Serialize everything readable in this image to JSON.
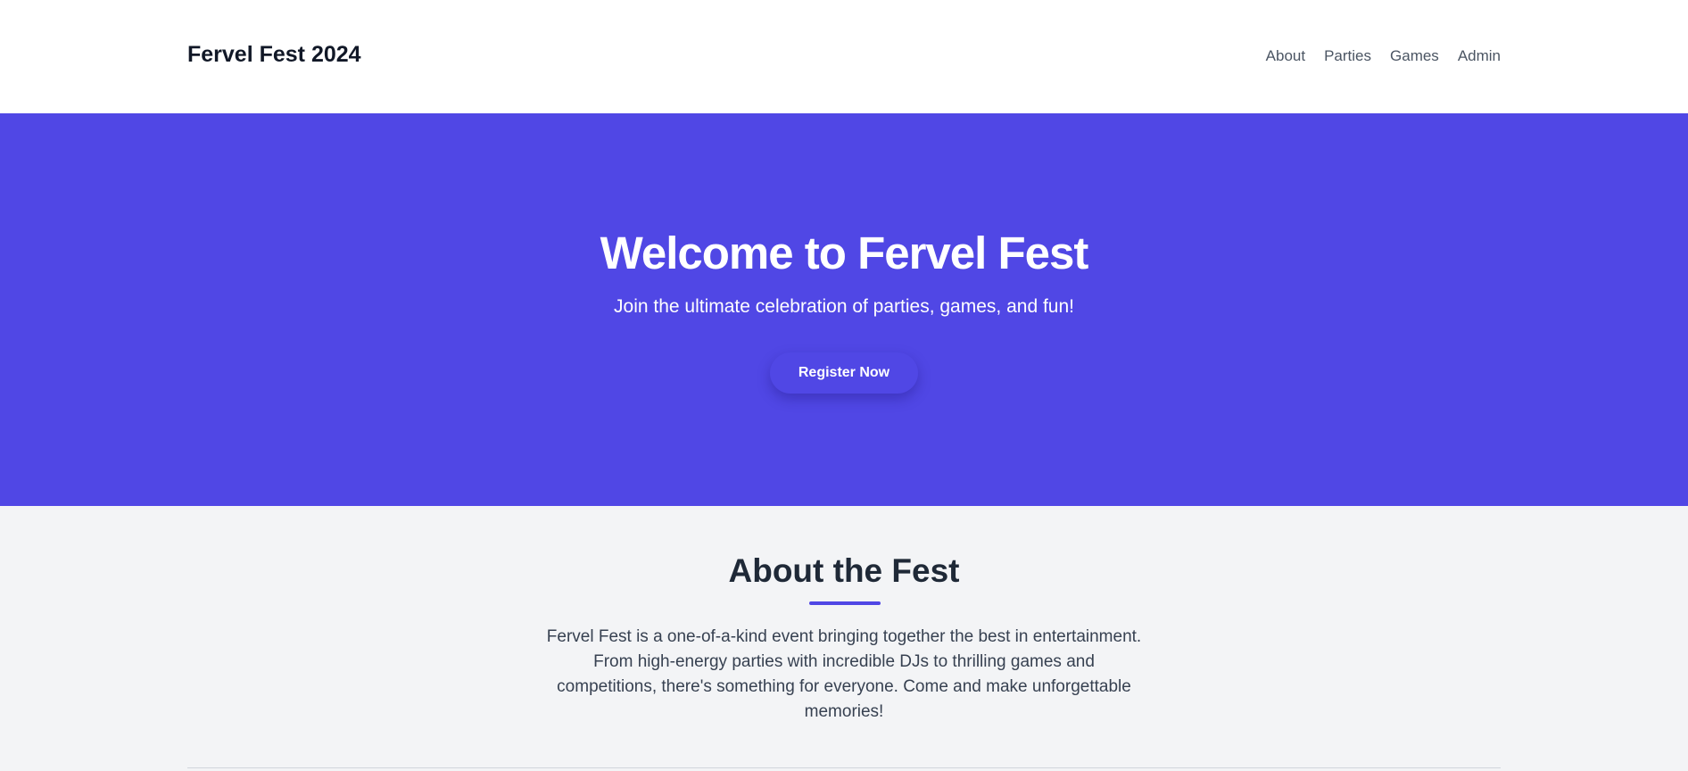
{
  "header": {
    "brand": "Fervel Fest 2024",
    "nav": [
      "About",
      "Parties",
      "Games",
      "Admin"
    ]
  },
  "hero": {
    "title": "Welcome to Fervel Fest",
    "subtitle": "Join the ultimate celebration of parties, games, and fun!",
    "cta_label": "Register Now",
    "background": "#5047e5"
  },
  "about": {
    "title": "About the Fest",
    "text": "Fervel Fest is a one-of-a-kind event bringing together the best in entertainment. From high-energy parties with incredible DJs to thrilling games and competitions, there's something for everyone. Come and make unforgettable memories!",
    "accent": "#5047e5"
  }
}
